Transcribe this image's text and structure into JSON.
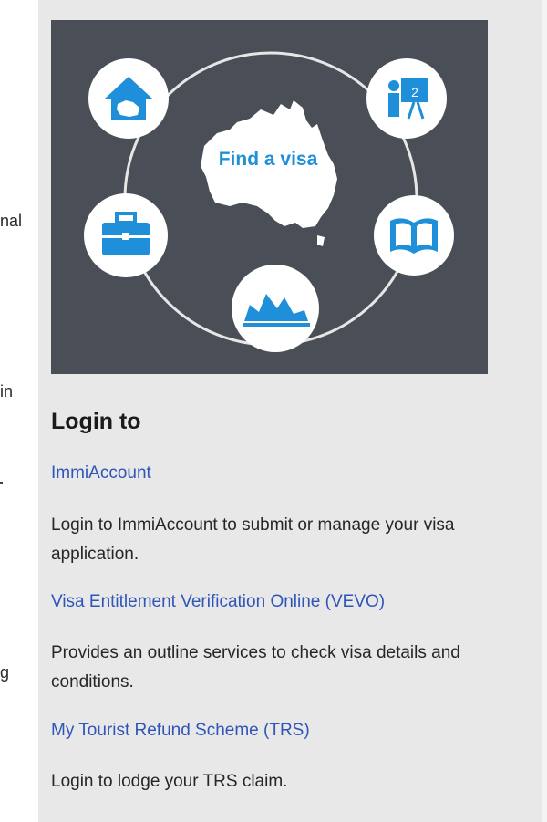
{
  "left_fragments": [
    "nal",
    "in",
    "g"
  ],
  "hero": {
    "title": "Find a visa",
    "colors": {
      "background": "#4a4f57",
      "accent": "#1e8fd8",
      "ring": "#e6e6e6"
    },
    "icons": [
      "house-australia-icon",
      "presentation-icon",
      "briefcase-icon",
      "book-icon",
      "opera-house-icon"
    ]
  },
  "login": {
    "heading": "Login to",
    "items": [
      {
        "link": "ImmiAccount",
        "description": "Login to ImmiAccount to submit or manage your visa application."
      },
      {
        "link": "Visa Entitlement Verification Online (VEVO)",
        "description": "Provides an outline services to check visa details and conditions."
      },
      {
        "link": "My Tourist Refund Scheme (TRS)",
        "description": "Login to lodge your TRS claim."
      }
    ]
  }
}
